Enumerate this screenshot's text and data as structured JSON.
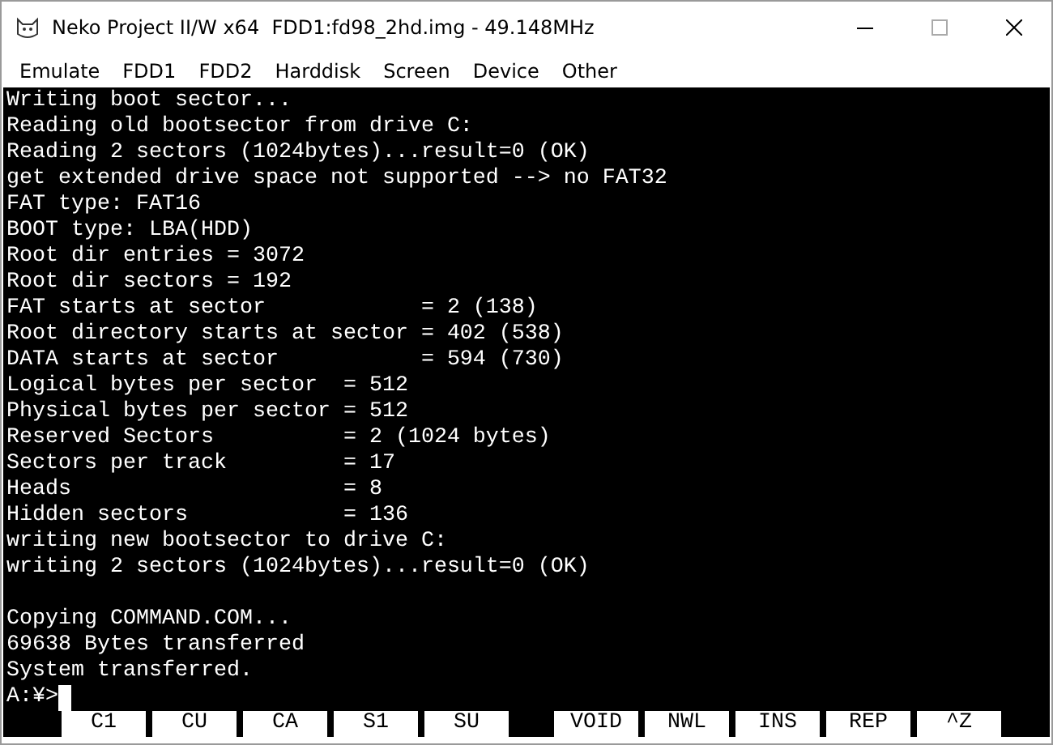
{
  "window": {
    "title": "Neko Project II/W x64  FDD1:fd98_2hd.img - 49.148MHz"
  },
  "menu": [
    "Emulate",
    "FDD1",
    "FDD2",
    "Harddisk",
    "Screen",
    "Device",
    "Other"
  ],
  "terminal": {
    "lines": [
      "Writing boot sector...",
      "Reading old bootsector from drive C:",
      "Reading 2 sectors (1024bytes)...result=0 (OK)",
      "get extended drive space not supported --> no FAT32",
      "FAT type: FAT16",
      "BOOT type: LBA(HDD)",
      "Root dir entries = 3072",
      "Root dir sectors = 192",
      "FAT starts at sector            = 2 (138)",
      "Root directory starts at sector = 402 (538)",
      "DATA starts at sector           = 594 (730)",
      "Logical bytes per sector  = 512",
      "Physical bytes per sector = 512",
      "Reserved Sectors          = 2 (1024 bytes)",
      "Sectors per track         = 17",
      "Heads                     = 8",
      "Hidden sectors            = 136",
      "writing new bootsector to drive C:",
      "writing 2 sectors (1024bytes)...result=0 (OK)"
    ],
    "lines_after_blank": [
      "Copying COMMAND.COM...",
      "69638 Bytes transferred",
      "System transferred."
    ],
    "prompt": "A:¥>",
    "function_keys": [
      [
        "C1",
        "CU",
        "CA",
        "S1",
        "SU"
      ],
      [
        "VOID",
        "NWL",
        "INS",
        "REP",
        "^Z"
      ]
    ]
  }
}
